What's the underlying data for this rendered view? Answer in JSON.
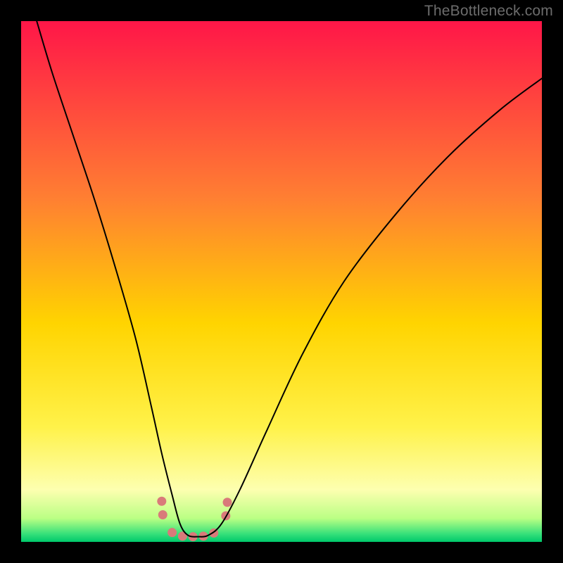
{
  "watermark": {
    "text": "TheBottleneck.com"
  },
  "chart_data": {
    "type": "line",
    "title": "",
    "xlabel": "",
    "ylabel": "",
    "xlim": [
      0,
      100
    ],
    "ylim": [
      0,
      100
    ],
    "background_gradient": {
      "stops": [
        {
          "pos": 0.0,
          "color": "#ff1648"
        },
        {
          "pos": 0.34,
          "color": "#ff7f32"
        },
        {
          "pos": 0.58,
          "color": "#ffd400"
        },
        {
          "pos": 0.78,
          "color": "#fff24a"
        },
        {
          "pos": 0.9,
          "color": "#fdffb0"
        },
        {
          "pos": 0.955,
          "color": "#baff84"
        },
        {
          "pos": 0.985,
          "color": "#35e07a"
        },
        {
          "pos": 1.0,
          "color": "#00c86b"
        }
      ]
    },
    "series": [
      {
        "name": "bottleneck-curve",
        "color": "#000000",
        "width": 2.0,
        "x": [
          3,
          6,
          10,
          14,
          18,
          22,
          25,
          27,
          29,
          30.5,
          32,
          34,
          36,
          38.5,
          42,
          47,
          54,
          62,
          72,
          82,
          92,
          100
        ],
        "y": [
          100,
          90,
          78,
          66,
          53,
          39,
          26,
          17,
          9,
          3.5,
          1.3,
          1.0,
          1.3,
          3.5,
          10,
          21,
          36,
          50,
          63,
          74,
          83,
          89
        ]
      }
    ],
    "markers": {
      "name": "data-points",
      "color": "#d97a7a",
      "radius": 6.5,
      "points": [
        {
          "x": 27.0,
          "y": 7.8
        },
        {
          "x": 27.2,
          "y": 5.2
        },
        {
          "x": 29.0,
          "y": 1.8
        },
        {
          "x": 31.0,
          "y": 1.1
        },
        {
          "x": 33.0,
          "y": 1.0
        },
        {
          "x": 35.0,
          "y": 1.1
        },
        {
          "x": 37.0,
          "y": 1.7
        },
        {
          "x": 39.3,
          "y": 5.0
        },
        {
          "x": 39.6,
          "y": 7.6
        }
      ]
    }
  }
}
